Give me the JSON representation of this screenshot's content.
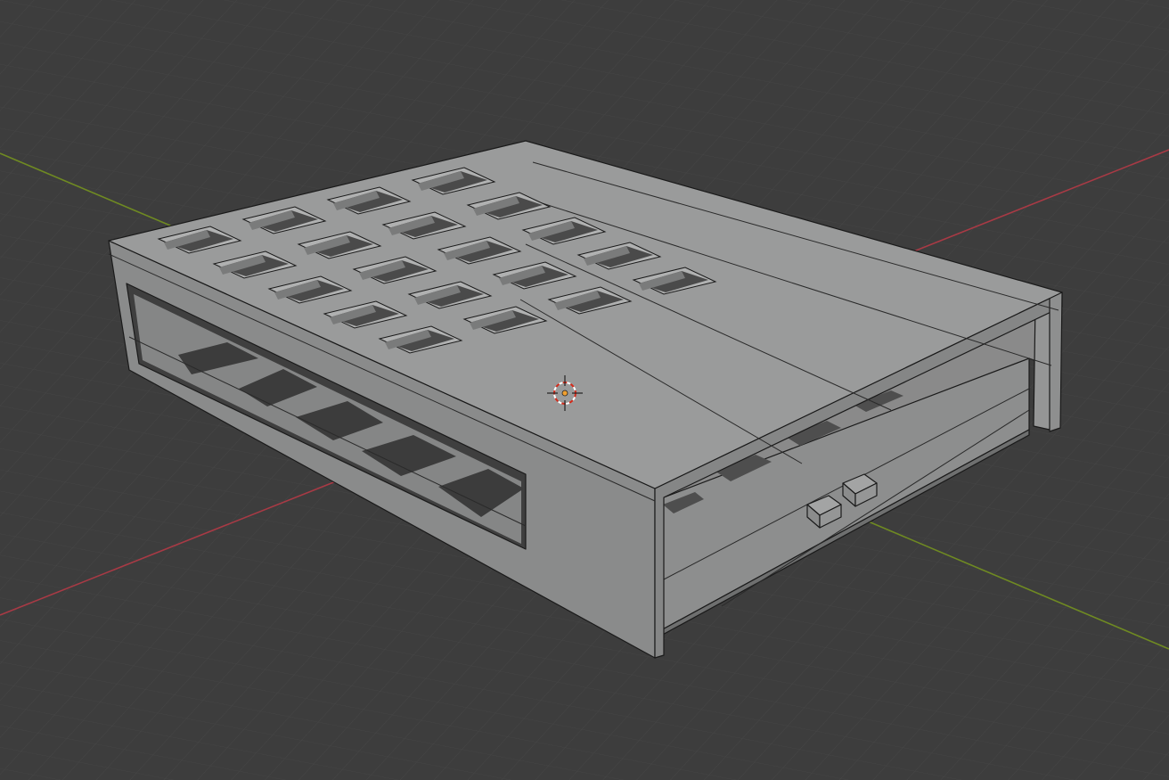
{
  "app": "3D viewport",
  "viewport": {
    "background": "#3d3d3d",
    "grid_color": "#474747",
    "x_axis_color": "#a83a45",
    "y_axis_color": "#6f8a22",
    "object_top_color": "#9a9b9b",
    "object_side_color": "#8a8b8b",
    "object_front_color": "#7f8080",
    "hole_color": "#4a4a4a",
    "cursor_color": "#d42a1a"
  },
  "scene": {
    "object": "perforated-box-enclosure",
    "top_holes_rows": 5,
    "top_holes_columns": 4,
    "side_window_slots": 5
  }
}
